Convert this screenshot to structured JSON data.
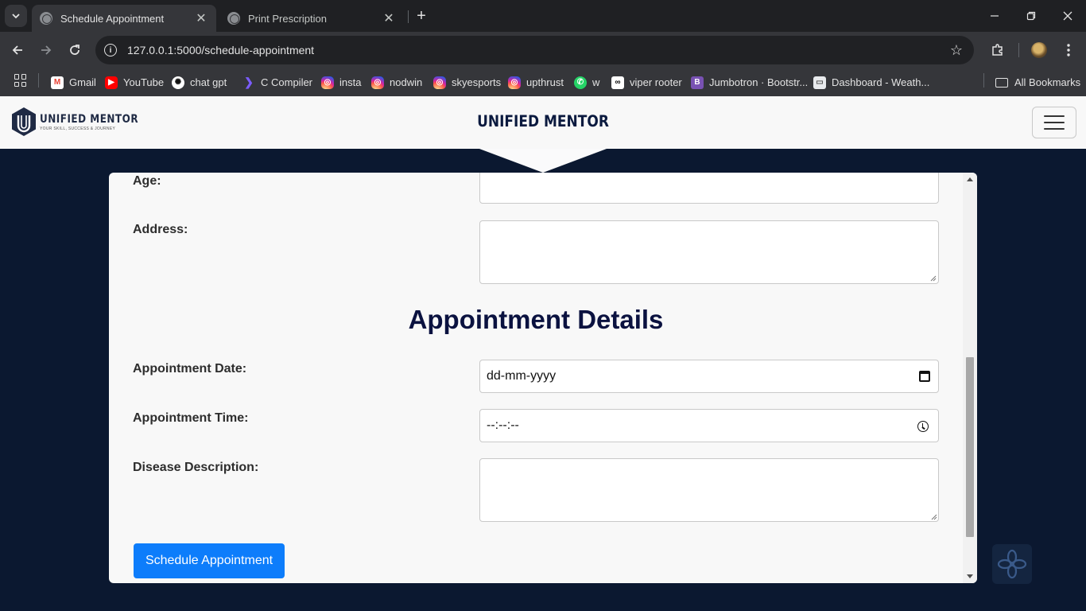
{
  "browser": {
    "tabs": [
      {
        "title": "Schedule Appointment",
        "active": true
      },
      {
        "title": "Print Prescription",
        "active": false
      }
    ],
    "url": "127.0.0.1:5000/schedule-appointment",
    "url_host": "127.0.0.1",
    "url_path": ":5000/schedule-appointment",
    "bookmarks": [
      {
        "label": "Gmail",
        "icon": "gmail-icon"
      },
      {
        "label": "YouTube",
        "icon": "youtube-icon"
      },
      {
        "label": "chat gpt",
        "icon": "chatgpt-icon"
      },
      {
        "label": "C Compiler",
        "icon": "compiler-icon"
      },
      {
        "label": "insta",
        "icon": "instagram-icon"
      },
      {
        "label": "nodwin",
        "icon": "instagram-icon"
      },
      {
        "label": "skyesports",
        "icon": "instagram-icon"
      },
      {
        "label": "upthrust",
        "icon": "instagram-icon"
      },
      {
        "label": "w",
        "icon": "whatsapp-icon"
      },
      {
        "label": "viper rooter",
        "icon": "viper-icon"
      },
      {
        "label": "Jumbotron · Bootstr...",
        "icon": "bootstrap-icon"
      },
      {
        "label": "Dashboard - Weath...",
        "icon": "dashboard-icon"
      }
    ],
    "all_bookmarks": "All Bookmarks"
  },
  "site": {
    "logo_title": "UNIFIED MENTOR",
    "logo_tagline": "YOUR SKILL, SUCCESS & JOURNEY",
    "brand": "UNIFIED MENTOR"
  },
  "form": {
    "age_label": "Age:",
    "age_value": "",
    "address_label": "Address:",
    "address_value": "",
    "section_title": "Appointment Details",
    "date_label": "Appointment Date:",
    "date_placeholder": "dd-mm-yyyy",
    "time_label": "Appointment Time:",
    "time_placeholder": "--:--:--",
    "disease_label": "Disease Description:",
    "disease_value": "",
    "submit_label": "Schedule Appointment"
  },
  "colors": {
    "page_background": "#0b1830",
    "primary_button": "#0d7dfb",
    "heading": "#0b1240"
  }
}
